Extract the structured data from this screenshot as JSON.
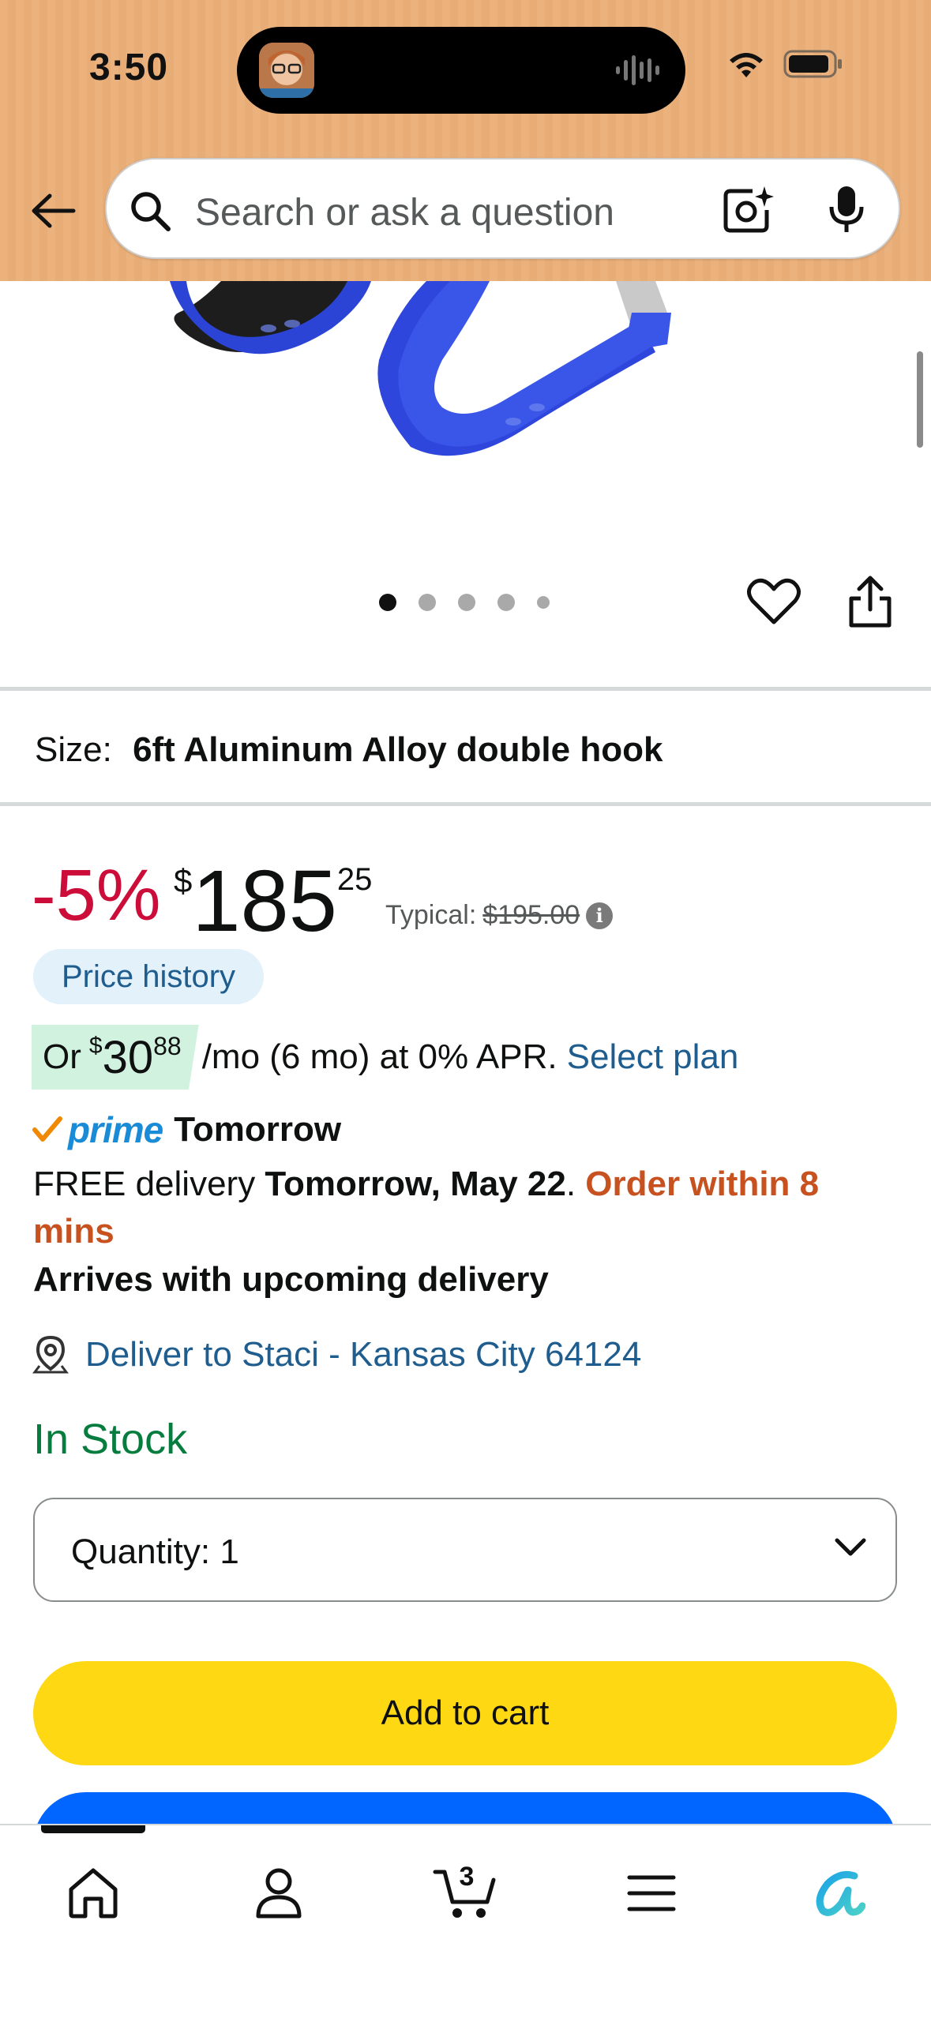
{
  "status_bar": {
    "time": "3:50"
  },
  "search": {
    "placeholder": "Search or ask a question"
  },
  "gallery": {
    "image_count": 5,
    "active_index": 0
  },
  "size": {
    "label": "Size:",
    "value": "6ft Aluminum Alloy double hook"
  },
  "price": {
    "discount": "-5%",
    "currency_symbol": "$",
    "whole": "185",
    "fraction": "25",
    "typical_label": "Typical:",
    "typical_value": "$195.00"
  },
  "price_history_label": "Price history",
  "plan": {
    "prefix": "Or",
    "currency_symbol": "$",
    "whole": "30",
    "fraction": "88",
    "suffix": "/mo (6 mo) at 0% APR.",
    "link": "Select plan"
  },
  "prime": {
    "badge": "prime",
    "label": "Tomorrow"
  },
  "delivery": {
    "prefix": "FREE delivery",
    "date": "Tomorrow, May 22",
    "urgency": "Order within 8 mins",
    "arrives": "Arrives with upcoming delivery"
  },
  "deliver_to": "Deliver to Staci - Kansas City 64124",
  "stock": "In Stock",
  "quantity": {
    "label": "Quantity:",
    "value": "1"
  },
  "buttons": {
    "add_to_cart": "Add to cart"
  },
  "bottom_nav": {
    "items": [
      {
        "icon": "home-icon"
      },
      {
        "icon": "account-icon"
      },
      {
        "icon": "cart-icon",
        "count": "3"
      },
      {
        "icon": "menu-icon"
      },
      {
        "icon": "rufus-icon"
      }
    ]
  },
  "colors": {
    "header": "#ebb27d",
    "discount": "#cc0c39",
    "link": "#1f5d8f",
    "prime": "#1a8bd6",
    "urgent": "#c7511f",
    "in_stock": "#067d3e",
    "add_to_cart": "#ffd814",
    "buy_now": "#0066ff"
  }
}
